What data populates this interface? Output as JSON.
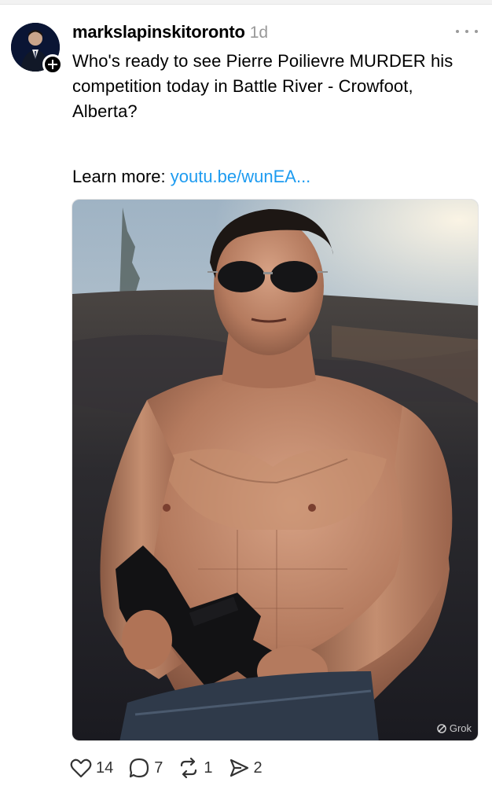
{
  "post": {
    "username": "markslapinskitoronto",
    "timestamp": "1d",
    "text": "Who's ready to see Pierre Poilievre MURDER his competition today in Battle River - Crowfoot, Alberta?",
    "learn_more_label": "Learn more: ",
    "link_text": "youtu.be/wunEA...",
    "watermark": "Grok",
    "actions": {
      "likes": "14",
      "replies": "7",
      "reposts": "1",
      "shares": "2"
    }
  },
  "icons": {
    "follow": "plus-icon",
    "more": "ellipsis-icon",
    "like": "heart-icon",
    "reply": "comment-icon",
    "repost": "repost-icon",
    "share": "send-icon",
    "watermark": "grok-icon"
  },
  "colors": {
    "link": "#1d9bf0",
    "timestamp": "#999999",
    "text": "#000000"
  }
}
